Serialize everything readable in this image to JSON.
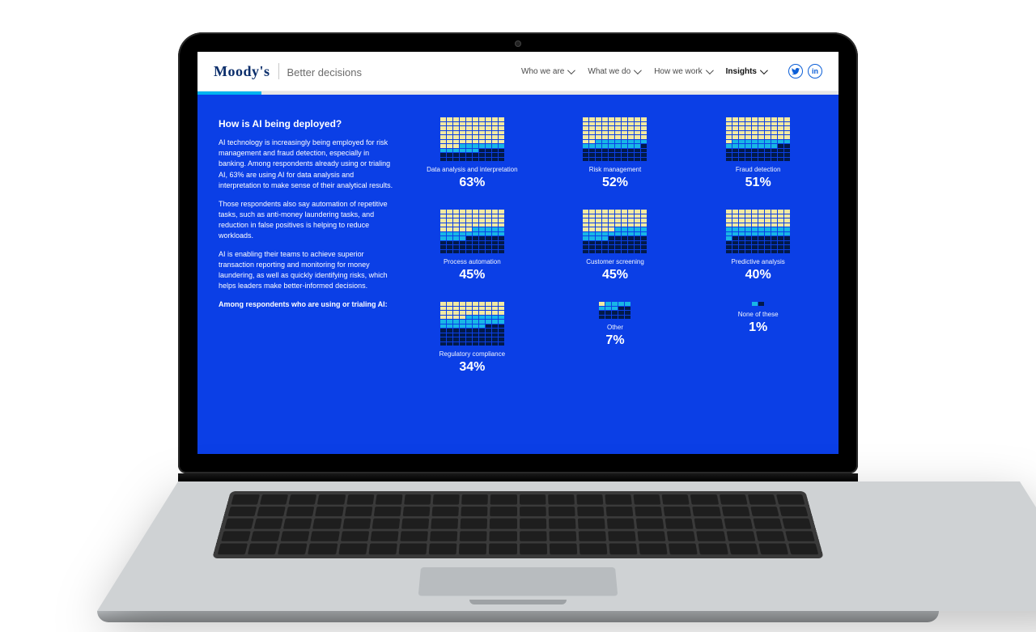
{
  "brand": {
    "logo_text": "Moody's",
    "tagline": "Better decisions",
    "apostrophe_nudge": "’"
  },
  "nav": {
    "items": [
      {
        "label": "Who we are",
        "active": false
      },
      {
        "label": "What we do",
        "active": false
      },
      {
        "label": "How we work",
        "active": false
      },
      {
        "label": "Insights",
        "active": true
      }
    ]
  },
  "socials": {
    "twitter_label": "t",
    "linkedin_label": "in"
  },
  "article": {
    "heading": "How is AI being deployed?",
    "p1": "AI technology is increasingly being employed for risk management and fraud detection, especially in banking. Among respondents already using or trialing AI, 63% are using AI for data analysis and interpretation to make sense of their analytical results.",
    "p2": "Those respondents also say automation of repetitive tasks, such as anti-money laundering tasks, and reduction in false positives is helping to reduce workloads.",
    "p3": "AI is enabling their teams to achieve superior transaction reporting and monitoring for money laundering, as well as quickly identifying risks, which helps leaders make better-informed decisions.",
    "closing": "Among respondents who are using or trialing AI:"
  },
  "chart_data": {
    "type": "bar",
    "title": "How is AI being deployed?",
    "categories": [
      "Data analysis and interpretation",
      "Risk management",
      "Fraud detection",
      "Process automation",
      "Customer screening",
      "Predictive analysis",
      "Regulatory compliance",
      "Other",
      "None of these"
    ],
    "values": [
      63,
      52,
      51,
      45,
      45,
      40,
      34,
      7,
      1
    ],
    "value_suffix": "%",
    "ylim": [
      0,
      100
    ],
    "color_bands": {
      "primary": "#f3e9a1",
      "secondary": "#18b6e6",
      "tertiary": "#021a4a"
    },
    "n_cells": 100
  }
}
